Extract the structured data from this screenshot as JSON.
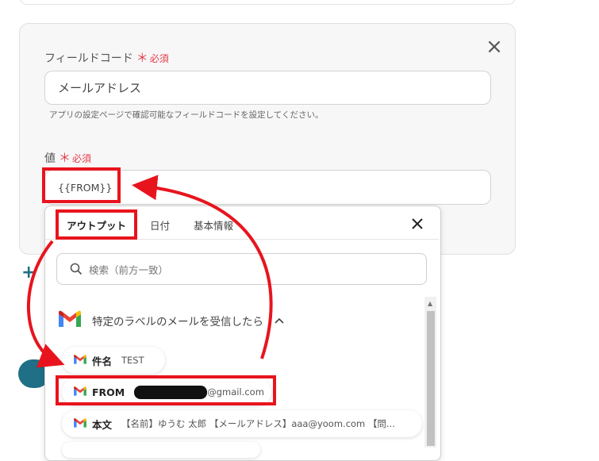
{
  "field_code": {
    "label": "フィールドコード",
    "required_star": "＊",
    "required_text": "必須",
    "value": "メールアドレス",
    "help": "アプリの設定ページで確認可能なフィールドコードを設定してください。"
  },
  "value_field": {
    "label": "値",
    "required_star": "＊",
    "required_text": "必須",
    "value": "{{FROM}}"
  },
  "panel": {
    "tabs": [
      {
        "label": "アウトプット"
      },
      {
        "label": "日付"
      },
      {
        "label": "基本情報"
      }
    ],
    "search_placeholder": "検索（前方一致）",
    "group_title": "特定のラベルのメールを受信したら",
    "items": [
      {
        "key": "件名",
        "value": "TEST"
      },
      {
        "key": "FROM",
        "value": "@gmail.com"
      },
      {
        "key": "本文",
        "value": "【名前】ゆうむ 太郎 【メールアドレス】aaa@yoom.com 【問..."
      }
    ]
  },
  "icons": {
    "close": "close-icon",
    "search": "search-icon",
    "gmail": "gmail-icon",
    "chevron": "chevron-up-icon",
    "plus": "plus-icon"
  },
  "colors": {
    "accent_red": "#e8141d",
    "required_red": "#e53b4a",
    "teal": "#1f6f86"
  }
}
